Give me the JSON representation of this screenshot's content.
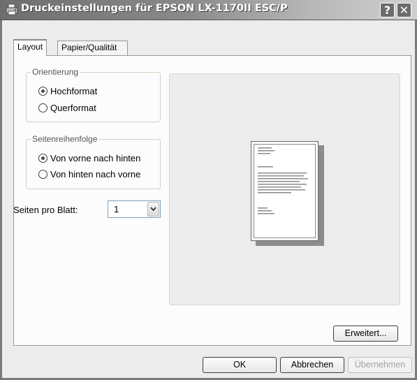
{
  "window": {
    "title": "Druckeinstellungen für EPSON LX-1170II ESC/P",
    "help_glyph": "?",
    "close_glyph": "✕",
    "title_icon": "printer-icon"
  },
  "tabs": [
    {
      "label": "Layout",
      "selected": true
    },
    {
      "label": "Papier/Qualität",
      "selected": false
    }
  ],
  "orientation": {
    "legend": "Orientierung",
    "options": [
      {
        "label": "Hochformat",
        "checked": true
      },
      {
        "label": "Querformat",
        "checked": false
      }
    ]
  },
  "page_order": {
    "legend": "Seitenreihenfolge",
    "options": [
      {
        "label": "Von vorne nach hinten",
        "checked": true
      },
      {
        "label": "Von hinten nach vorne",
        "checked": false
      }
    ]
  },
  "pages_per_sheet": {
    "label": "Seiten pro Blatt:",
    "value": "1"
  },
  "buttons": {
    "advanced": "Erweitert...",
    "ok": "OK",
    "cancel": "Abbrechen",
    "apply": "Übernehmen"
  },
  "colors": {
    "titlebar": "#6e6e6e",
    "panel": "#fcfcfc",
    "disabled_text": "#a2a2a2"
  }
}
